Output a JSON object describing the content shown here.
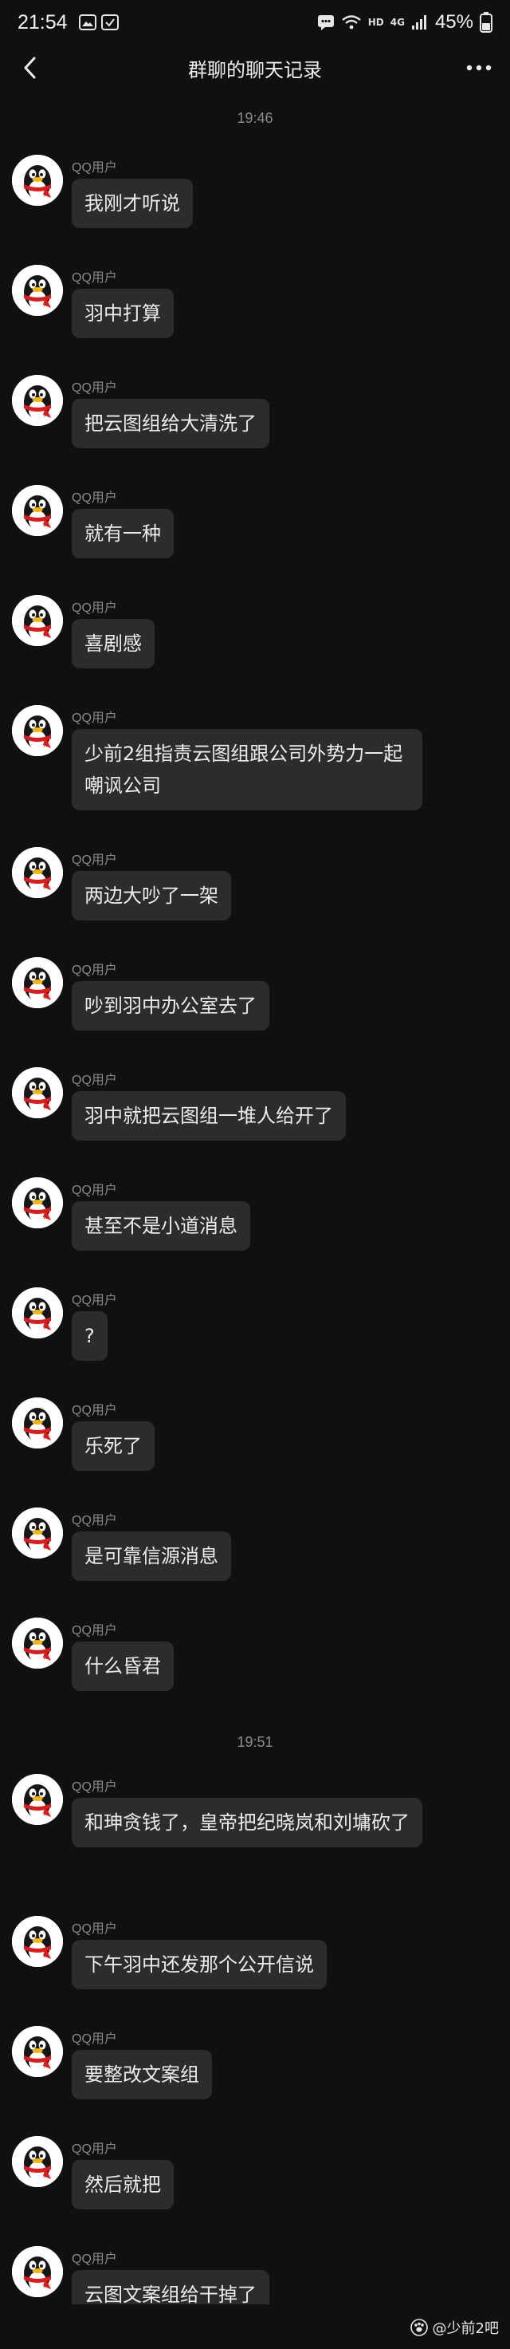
{
  "status_bar": {
    "time": "21:54",
    "hd_label": "HD",
    "network_label": "4G",
    "battery": "45%"
  },
  "nav": {
    "title": "群聊的聊天记录"
  },
  "timestamps": [
    "19:46",
    "19:51"
  ],
  "sender_name": "QQ用户",
  "messages": [
    {
      "text": "我刚才听说"
    },
    {
      "text": "羽中打算"
    },
    {
      "text": "把云图组给大清洗了"
    },
    {
      "text": "就有一种"
    },
    {
      "text": "喜剧感"
    },
    {
      "text": "少前2组指责云图组跟公司外势力一起嘲讽公司"
    },
    {
      "text": "两边大吵了一架"
    },
    {
      "text": "吵到羽中办公室去了"
    },
    {
      "text": "羽中就把云图组一堆人给开了"
    },
    {
      "text": "甚至不是小道消息"
    },
    {
      "text": "?"
    },
    {
      "text": "乐死了"
    },
    {
      "text": "是可靠信源消息"
    },
    {
      "text": "什么昏君"
    },
    {
      "text": "和珅贪钱了，皇帝把纪晓岚和刘墉砍了"
    },
    {
      "text": "下午羽中还发那个公开信说"
    },
    {
      "text": "要整改文案组"
    },
    {
      "text": "然后就把"
    },
    {
      "text": "云图文案组给干掉了"
    }
  ],
  "watermark": "@少前2吧",
  "colors": {
    "background": "#101010",
    "bubble": "#2c2c2c",
    "avatar_scarf": "#e01a1a",
    "avatar_beak": "#f5b400"
  }
}
